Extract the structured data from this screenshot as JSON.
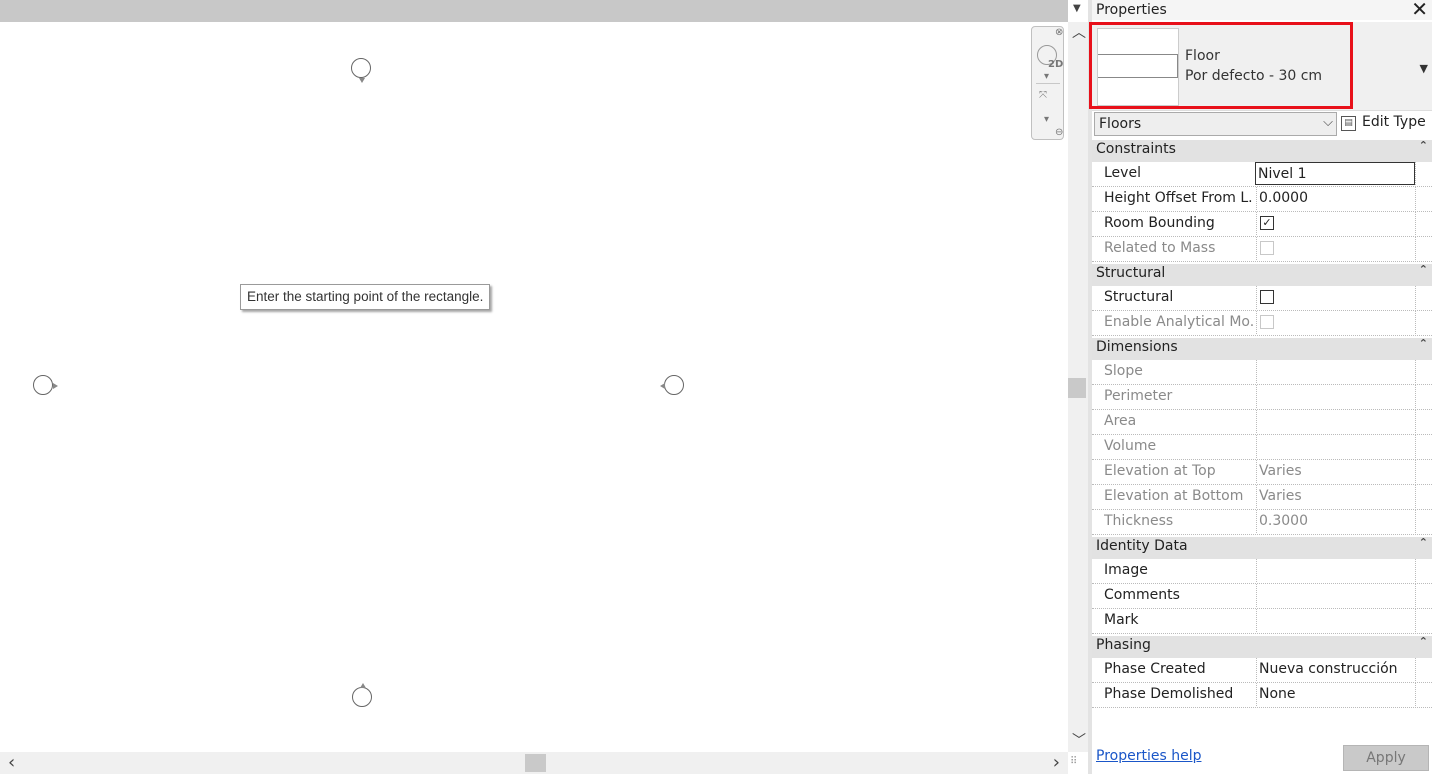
{
  "canvas": {
    "tooltip": "Enter the starting point of the rectangle.",
    "navbar": {
      "badge_2d": "2D"
    }
  },
  "properties": {
    "title": "Properties",
    "type_selector": {
      "family": "Floor",
      "type": "Por defecto - 30 cm",
      "highlight_color": "#e8101a"
    },
    "category": "Floors",
    "edit_type_label": "Edit Type",
    "groups": {
      "constraints": {
        "label": "Constraints",
        "level": {
          "name": "Level",
          "value": "Nivel 1"
        },
        "height_offset": {
          "name": "Height Offset From L...",
          "value": "0.0000"
        },
        "room_bounding": {
          "name": "Room Bounding",
          "checked": true
        },
        "related_to_mass": {
          "name": "Related to Mass",
          "checked": false
        }
      },
      "structural": {
        "label": "Structural",
        "structural": {
          "name": "Structural",
          "checked": false
        },
        "enable_analytical": {
          "name": "Enable Analytical Mo...",
          "checked": false
        }
      },
      "dimensions": {
        "label": "Dimensions",
        "slope": {
          "name": "Slope",
          "value": ""
        },
        "perimeter": {
          "name": "Perimeter",
          "value": ""
        },
        "area": {
          "name": "Area",
          "value": ""
        },
        "volume": {
          "name": "Volume",
          "value": ""
        },
        "elev_top": {
          "name": "Elevation at Top",
          "value": "Varies"
        },
        "elev_bottom": {
          "name": "Elevation at Bottom",
          "value": "Varies"
        },
        "thickness": {
          "name": "Thickness",
          "value": "0.3000"
        }
      },
      "identity": {
        "label": "Identity Data",
        "image": {
          "name": "Image",
          "value": ""
        },
        "comments": {
          "name": "Comments",
          "value": ""
        },
        "mark": {
          "name": "Mark",
          "value": ""
        }
      },
      "phasing": {
        "label": "Phasing",
        "phase_created": {
          "name": "Phase Created",
          "value": "Nueva construcción"
        },
        "phase_demolished": {
          "name": "Phase Demolished",
          "value": "None"
        }
      }
    },
    "footer": {
      "help_link": "Properties help",
      "apply_label": "Apply"
    }
  }
}
